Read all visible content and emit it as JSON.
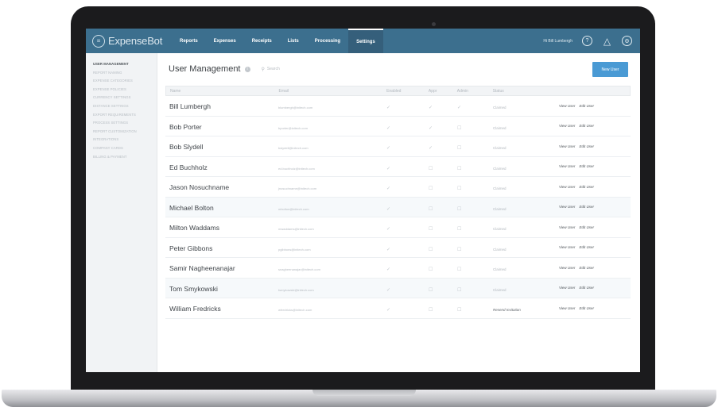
{
  "app": {
    "brand": "ExpenseBot",
    "colors": {
      "nav": "#3c6f8e",
      "primary_button": "#4a9ad4",
      "sidebar": "#f1f3f5"
    }
  },
  "topnav": {
    "items": [
      {
        "label": "Reports",
        "active": false
      },
      {
        "label": "Expenses",
        "active": false
      },
      {
        "label": "Receipts",
        "active": false
      },
      {
        "label": "Lists",
        "active": false
      },
      {
        "label": "Processing",
        "active": false
      },
      {
        "label": "Settings",
        "active": true
      }
    ],
    "user": "Hi Bill Lumbergh",
    "icons": [
      "help-circle-icon",
      "warning-triangle-icon",
      "settings-gear-icon"
    ]
  },
  "sidebar": {
    "items": [
      {
        "label": "USER MANAGEMENT",
        "active": true
      },
      {
        "label": "REPORT NAMING",
        "active": false
      },
      {
        "label": "EXPENSE CATEGORIES",
        "active": false
      },
      {
        "label": "EXPENSE POLICIES",
        "active": false
      },
      {
        "label": "CURRENCY SETTINGS",
        "active": false
      },
      {
        "label": "DISTANCE SETTINGS",
        "active": false
      },
      {
        "label": "EXPORT REQUIREMENTS",
        "active": false
      },
      {
        "label": "PROCESS SETTINGS",
        "active": false
      },
      {
        "label": "REPORT CUSTOMIZATION",
        "active": false
      },
      {
        "label": "INTEGRATIONS",
        "active": false
      },
      {
        "label": "COMPANY CARDS",
        "active": false
      },
      {
        "label": "BILLING & PAYMENT",
        "active": false
      }
    ]
  },
  "main": {
    "title": "User Management",
    "search_placeholder": "Search",
    "new_user_label": "New User",
    "columns": [
      "Name",
      "Email",
      "Enabled",
      "Appr",
      "Admin",
      "Status"
    ],
    "action_labels": {
      "view": "View User",
      "edit": "Edit User"
    },
    "rows": [
      {
        "name": "Bill Lumbergh",
        "email": "blumbergh@initech.com",
        "enabled": true,
        "approver": true,
        "admin": true,
        "status": "Claimed",
        "highlight": false
      },
      {
        "name": "Bob Porter",
        "email": "bporter@initech.com",
        "enabled": true,
        "approver": true,
        "admin": false,
        "status": "Claimed",
        "highlight": false
      },
      {
        "name": "Bob Slydell",
        "email": "bslydell@initech.com",
        "enabled": true,
        "approver": true,
        "admin": false,
        "status": "Claimed",
        "highlight": false
      },
      {
        "name": "Ed Buchholz",
        "email": "ed.buchholz@initech.com",
        "enabled": true,
        "approver": false,
        "admin": false,
        "status": "Claimed",
        "highlight": false
      },
      {
        "name": "Jason Nosuchname",
        "email": "jnosuchname@initech.com",
        "enabled": true,
        "approver": false,
        "admin": false,
        "status": "Claimed",
        "highlight": false
      },
      {
        "name": "Michael Bolton",
        "email": "mbolton@initech.com",
        "enabled": true,
        "approver": false,
        "admin": false,
        "status": "Claimed",
        "highlight": true
      },
      {
        "name": "Milton Waddams",
        "email": "mwaddams@initech.com",
        "enabled": true,
        "approver": false,
        "admin": false,
        "status": "Claimed",
        "highlight": false
      },
      {
        "name": "Peter Gibbons",
        "email": "pgibbons@initech.com",
        "enabled": true,
        "approver": false,
        "admin": false,
        "status": "Claimed",
        "highlight": false
      },
      {
        "name": "Samir Nagheenanajar",
        "email": "snagheenanajar@initech.com",
        "enabled": true,
        "approver": false,
        "admin": false,
        "status": "Claimed",
        "highlight": false
      },
      {
        "name": "Tom Smykowski",
        "email": "tsmykowski@initech.com",
        "enabled": true,
        "approver": false,
        "admin": false,
        "status": "Claimed",
        "highlight": true
      },
      {
        "name": "William Fredricks",
        "email": "wfredricks@initech.com",
        "enabled": true,
        "approver": false,
        "admin": false,
        "status": "Resend Invitation",
        "highlight": false
      }
    ]
  }
}
